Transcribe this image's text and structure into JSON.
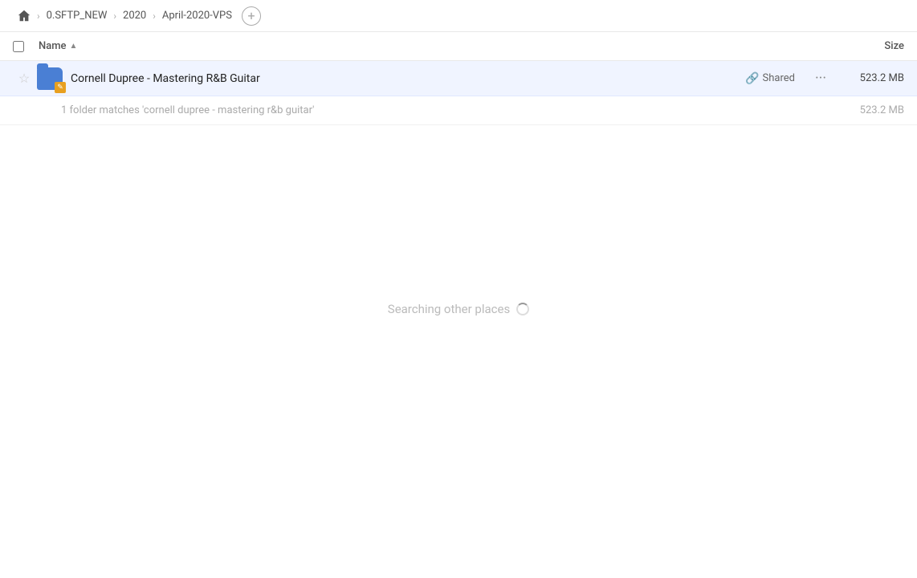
{
  "breadcrumb": {
    "home_icon": "🏠",
    "items": [
      {
        "label": "0.SFTP_NEW"
      },
      {
        "label": "2020"
      },
      {
        "label": "April-2020-VPS"
      }
    ],
    "add_label": "+"
  },
  "columns": {
    "name_label": "Name",
    "sort_arrow": "▲",
    "size_label": "Size"
  },
  "file_row": {
    "folder_name": "Cornell Dupree - Mastering R&B Guitar",
    "shared_label": "Shared",
    "more_icon": "···",
    "size": "523.2 MB"
  },
  "match_info": {
    "text": "1 folder matches 'cornell dupree - mastering r&b guitar'",
    "size": "523.2 MB"
  },
  "searching": {
    "text": "Searching other places"
  }
}
